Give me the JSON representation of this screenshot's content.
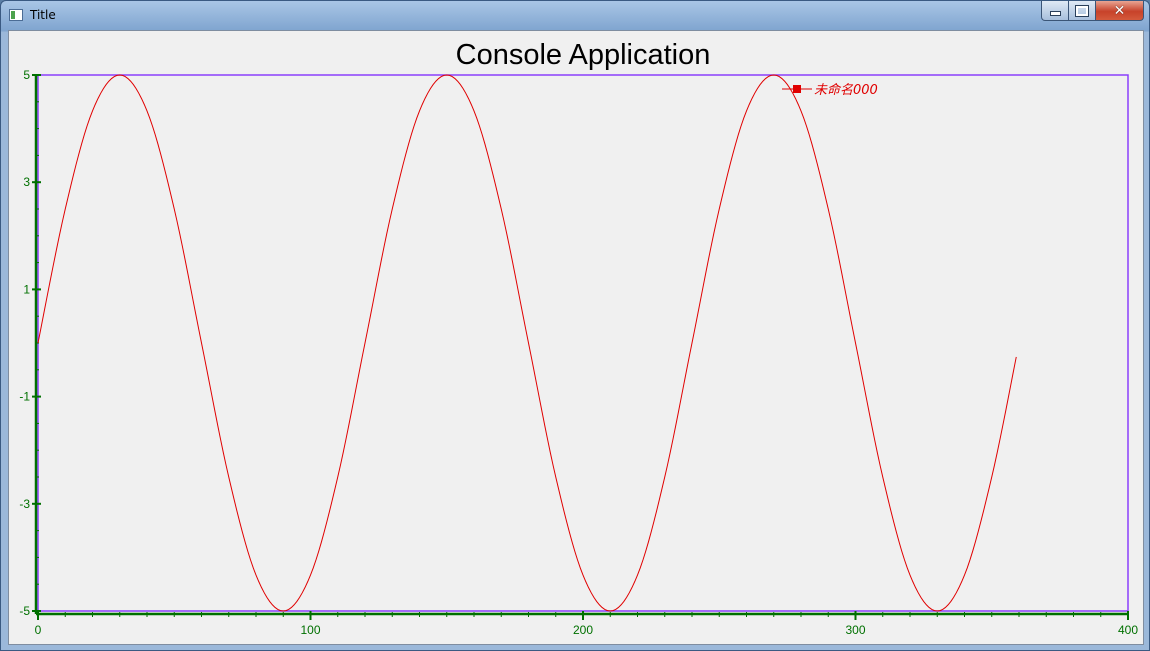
{
  "window": {
    "title": "Title",
    "controls": {
      "minimize": "minimize",
      "maximize": "maximize",
      "close": "close"
    }
  },
  "colors": {
    "frame": "#8a3ffc",
    "axis": "#007000",
    "curve": "#e00000",
    "background": "#f0f0f0"
  },
  "chart_data": {
    "type": "line",
    "title": "Console Application",
    "xlabel": "",
    "ylabel": "",
    "xlim": [
      0,
      400
    ],
    "ylim": [
      -5,
      5
    ],
    "x_ticks": [
      0,
      100,
      200,
      300,
      400
    ],
    "y_ticks": [
      5,
      3,
      1,
      -1,
      -3,
      -5
    ],
    "x_tick_labels": [
      "0",
      "100",
      "200",
      "300",
      "400"
    ],
    "y_tick_labels": [
      "5",
      "3",
      "1",
      "-1",
      "-3",
      "-5"
    ],
    "grid": false,
    "legend_position": "top-right",
    "series": [
      {
        "name": "未命名000",
        "color": "#e00000",
        "x": [
          0,
          10,
          20,
          30,
          40,
          50,
          60,
          70,
          80,
          90,
          100,
          110,
          120,
          130,
          140,
          150,
          160,
          170,
          180,
          190,
          200,
          210,
          220,
          230,
          240,
          250,
          260,
          270,
          280,
          290,
          300,
          310,
          320,
          330,
          340,
          350,
          359
        ],
        "y": [
          0.0,
          2.5,
          4.33,
          5.0,
          4.33,
          2.5,
          0.0,
          -2.5,
          -4.33,
          -5.0,
          -4.33,
          -2.5,
          0.0,
          2.5,
          4.33,
          5.0,
          4.33,
          2.5,
          0.0,
          -2.5,
          -4.33,
          -5.0,
          -4.33,
          -2.5,
          0.0,
          2.5,
          4.33,
          5.0,
          4.33,
          2.5,
          0.0,
          -2.5,
          -4.33,
          -5.0,
          -4.33,
          -2.5,
          -0.26
        ]
      }
    ]
  }
}
